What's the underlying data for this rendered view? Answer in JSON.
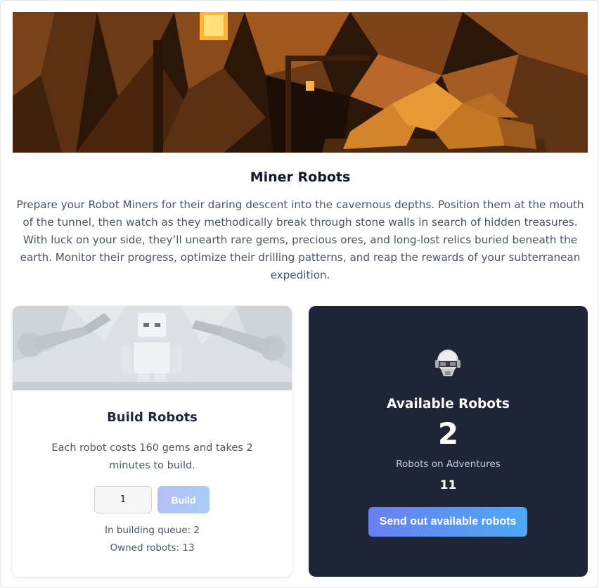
{
  "hero": {
    "image": "mine-tunnel-lowpoly-illustration"
  },
  "intro": {
    "title": "Miner Robots",
    "description": "Prepare your Robot Miners for their daring descent into the cavernous depths. Position them at the mouth of the tunnel, then watch as they methodically break through stone walls in search of hidden treasures. With luck on your side, they’ll unearth rare gems, precious ores, and long-lost relics buried beneath the earth. Monitor their progress, optimize their drilling patterns, and reap the rewards of your subterranean expedition."
  },
  "build": {
    "image": "robot-factory-illustration",
    "title": "Build Robots",
    "description": "Each robot costs 160 gems and takes 2 minutes to build.",
    "quantity": "1",
    "button_label": "Build",
    "queue_text": "In building queue: 2",
    "owned_text": "Owned robots: 13"
  },
  "available": {
    "icon": "robot-head-icon",
    "title": "Available Robots",
    "count": "2",
    "adventures_label": "Robots on Adventures",
    "adventures_count": "11",
    "send_button_label": "Send out available robots"
  },
  "colors": {
    "dark_card": "#1e2536",
    "accent_gradient_start": "#6a7ff0",
    "accent_gradient_end": "#4ca9f5"
  }
}
